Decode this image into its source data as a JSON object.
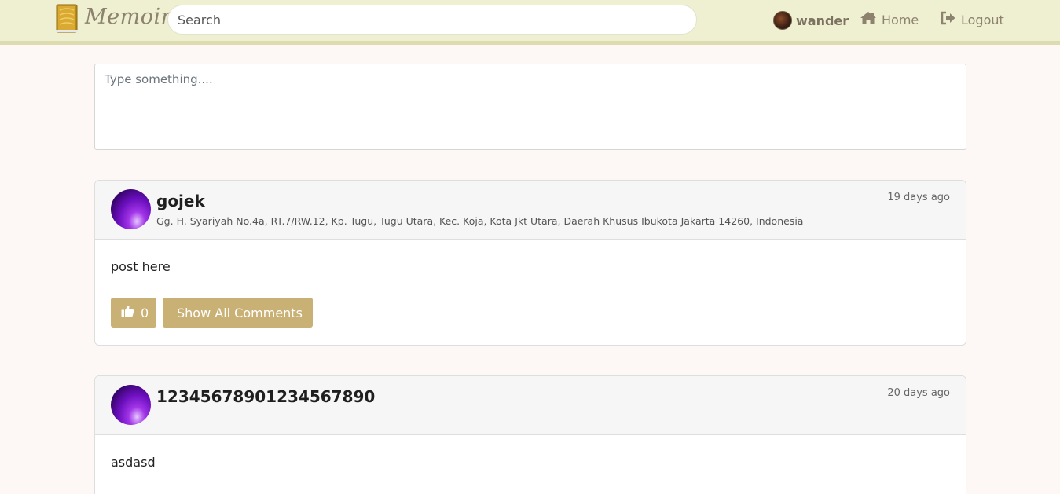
{
  "brand": {
    "name": "Memoir",
    "accent": "#c9b075",
    "nav_bg": "#efefd2"
  },
  "search": {
    "placeholder": "Search",
    "value": ""
  },
  "nav": {
    "username": "wander",
    "home_label": "Home",
    "logout_label": "Logout",
    "icons": {
      "home": "home-icon",
      "logout": "logout-icon"
    }
  },
  "composer": {
    "placeholder": "Type something....",
    "value": ""
  },
  "posts": [
    {
      "user": "gojek",
      "location": "Gg. H. Syariyah No.4a, RT.7/RW.12, Kp. Tugu, Tugu Utara, Kec. Koja, Kota Jkt Utara, Daerah Khusus Ibukota Jakarta 14260, Indonesia",
      "time": "19 days ago",
      "text": "post here",
      "likes": "0",
      "comments_label": "Show All Comments"
    },
    {
      "user": "12345678901234567890",
      "location": "",
      "time": "20 days ago",
      "text": "asdasd",
      "likes": "",
      "comments_label": ""
    }
  ]
}
